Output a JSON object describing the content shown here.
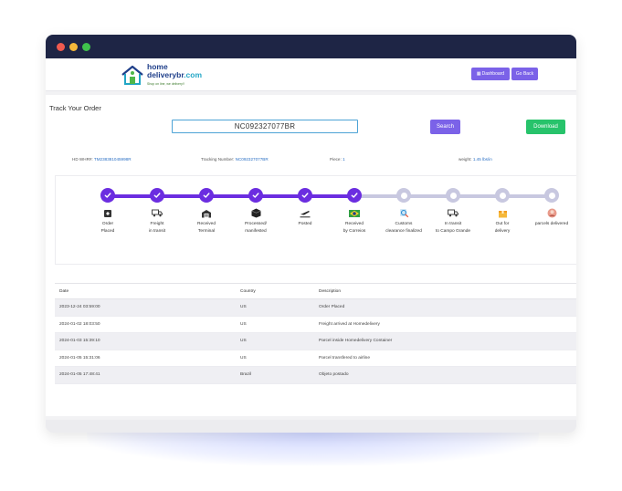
{
  "brand": {
    "line1": "home",
    "line2_main": "deliverybr",
    "line2_accent": ".com",
    "tagline": "Shop on line, we delivery!!"
  },
  "header_buttons": {
    "dashboard": "Dashboard",
    "go_back": "Go Back"
  },
  "tracking": {
    "title": "Track Your Order",
    "code": "NC092327077BR",
    "search_label": "Search",
    "download_label": "Download"
  },
  "info": {
    "hd_label": "HD WHR#:",
    "hd_value": "TM238381045998R",
    "tracking_label": "Tracking Number:",
    "tracking_value": "NC092327077BR",
    "piece_label": "Piece:",
    "piece_value": "1",
    "weight_label": "weight:",
    "weight_value": "1.45 lbs/in"
  },
  "timeline": {
    "completed_color": "#6b2de0",
    "pending_color": "#c8c8e0",
    "steps": [
      {
        "label1": "Order",
        "label2": "Placed",
        "icon": "box-icon",
        "done": true
      },
      {
        "label1": "Freight",
        "label2": "in transit",
        "icon": "truck-icon",
        "done": true
      },
      {
        "label1": "Received",
        "label2": "Terminal",
        "icon": "warehouse-icon",
        "done": true
      },
      {
        "label1": "Processed/",
        "label2": "manifested",
        "icon": "package-icon",
        "done": true
      },
      {
        "label1": "Posted",
        "label2": "",
        "icon": "plane-icon",
        "done": true
      },
      {
        "label1": "Received",
        "label2": "by Correios",
        "icon": "brazil-flag-icon",
        "done": true
      },
      {
        "label1": "Customs",
        "label2": "clearance finalized",
        "icon": "magnifier-icon",
        "done": false
      },
      {
        "label1": "In transit",
        "label2": "to Campo Grande",
        "icon": "truck-icon",
        "done": false
      },
      {
        "label1": "Out for",
        "label2": "delivery",
        "icon": "parcel-icon",
        "done": false
      },
      {
        "label1": "parcels delivered",
        "label2": "",
        "icon": "recipient-icon",
        "done": false
      }
    ]
  },
  "table": {
    "headers": {
      "date": "Date",
      "country": "Country",
      "description": "Description"
    },
    "rows": [
      {
        "date": "2023-12-24 03:59:00",
        "country": "US",
        "description": "Order Placed"
      },
      {
        "date": "2024-01-02 18:03:50",
        "country": "US",
        "description": "Freight arrived at Homedelivery"
      },
      {
        "date": "2024-01-03 15:39:10",
        "country": "US",
        "description": "Parcel inside Homedelivery Container"
      },
      {
        "date": "2024-01-05 15:31:06",
        "country": "US",
        "description": "Parcel transfered to airline"
      },
      {
        "date": "2024-01-05 17:48:41",
        "country": "Brazil",
        "description": "Objeto postado"
      }
    ]
  }
}
